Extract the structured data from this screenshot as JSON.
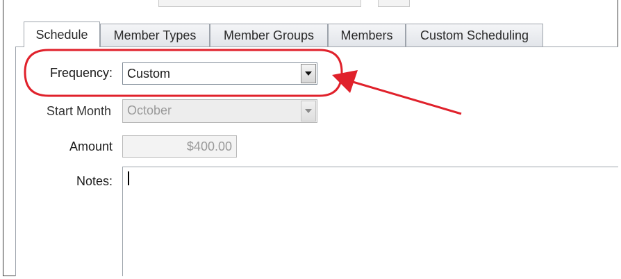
{
  "tabs": [
    {
      "label": "Schedule",
      "active": true
    },
    {
      "label": "Member Types",
      "active": false
    },
    {
      "label": "Member Groups",
      "active": false
    },
    {
      "label": "Members",
      "active": false
    },
    {
      "label": "Custom Scheduling",
      "active": false
    }
  ],
  "form": {
    "frequency": {
      "label": "Frequency:",
      "value": "Custom",
      "enabled": true
    },
    "start_month": {
      "label": "Start Month",
      "value": "October",
      "enabled": false
    },
    "amount": {
      "label": "Amount",
      "value": "$400.00",
      "enabled": false
    },
    "notes": {
      "label": "Notes:",
      "value": ""
    }
  },
  "icons": {
    "dropdown": "chevron-down-icon"
  },
  "annotation": {
    "color": "#e0212b",
    "shapes": [
      "ellipse-highlight",
      "arrow"
    ]
  }
}
